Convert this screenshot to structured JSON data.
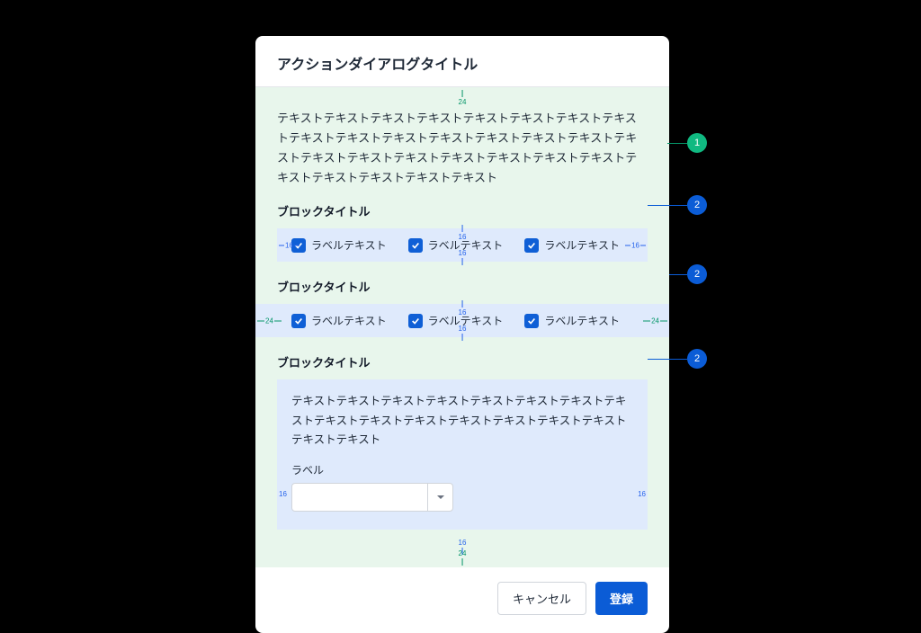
{
  "dialog": {
    "title": "アクションダイアログタイトル",
    "description": "テキストテキストテキストテキストテキストテキストテキストテキストテキストテキストテキストテキストテキストテキストテキストテキストテキストテキストテキストテキストテキストテキストテキストテキストテキストテキストテキストテキスト"
  },
  "blocks": [
    {
      "title": "ブロックタイトル",
      "checks": [
        "ラベルテキスト",
        "ラベルテキスト",
        "ラベルテキスト"
      ]
    },
    {
      "title": "ブロックタイトル",
      "checks": [
        "ラベルテキスト",
        "ラベルテキスト",
        "ラベルテキスト"
      ]
    },
    {
      "title": "ブロックタイトル",
      "body": "テキストテキストテキストテキストテキストテキストテキストテキストテキストテキストテキストテキストテキストテキストテキストテキストテキスト",
      "label": "ラベル"
    }
  ],
  "spacing": {
    "outer_v": "24",
    "inner_v": "16",
    "inner_h": "16"
  },
  "footer": {
    "cancel": "キャンセル",
    "submit": "登録"
  },
  "callouts": [
    "1",
    "2",
    "2",
    "2"
  ]
}
